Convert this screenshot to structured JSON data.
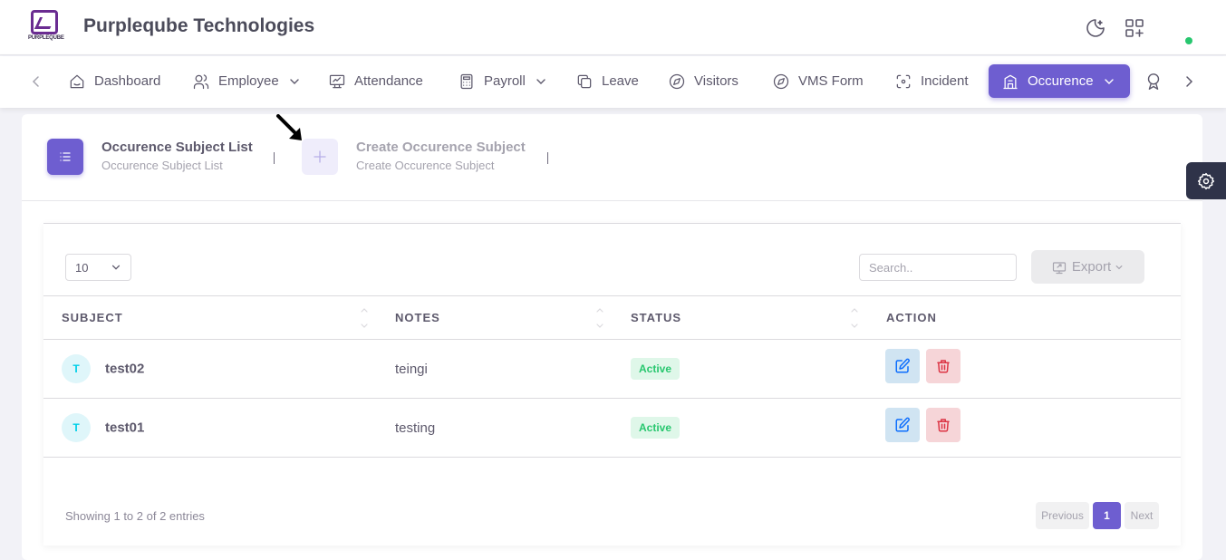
{
  "header": {
    "brand": "Purpleqube Technologies",
    "logo_text": "PURPLEQUBE",
    "icons": [
      "moon-icon",
      "apps-add-icon"
    ]
  },
  "navbar": {
    "items": [
      {
        "label": "Dashboard",
        "icon": "home-icon",
        "dropdown": false
      },
      {
        "label": "Employee",
        "icon": "users-icon",
        "dropdown": true
      },
      {
        "label": "Attendance",
        "icon": "chart-icon",
        "dropdown": false
      },
      {
        "label": "Payroll",
        "icon": "calculator-icon",
        "dropdown": true
      },
      {
        "label": "Leave",
        "icon": "copy-icon",
        "dropdown": false
      },
      {
        "label": "Visitors",
        "icon": "compass-icon",
        "dropdown": false
      },
      {
        "label": "VMS Form",
        "icon": "compass-icon",
        "dropdown": false
      },
      {
        "label": "Incident",
        "icon": "focus-icon",
        "dropdown": false
      },
      {
        "label": "Occurence",
        "icon": "building-icon",
        "dropdown": true,
        "active": true
      }
    ]
  },
  "tabs": [
    {
      "title": "Occurence Subject List",
      "subtitle": "Occurence Subject List",
      "active": true
    },
    {
      "title": "Create Occurence Subject",
      "subtitle": "Create Occurence Subject",
      "active": false
    }
  ],
  "table_controls": {
    "page_length": "10",
    "search_placeholder": "Search..",
    "export_label": "Export"
  },
  "table": {
    "columns": [
      "SUBJECT",
      "NOTES",
      "STATUS",
      "ACTION"
    ],
    "rows": [
      {
        "avatar": "T",
        "subject": "test02",
        "notes": "teingi",
        "status": "Active"
      },
      {
        "avatar": "T",
        "subject": "test01",
        "notes": "testing",
        "status": "Active"
      }
    ]
  },
  "footer": {
    "info": "Showing 1 to 2 of 2 entries",
    "previous": "Previous",
    "current_page": "1",
    "next": "Next"
  },
  "colors": {
    "primary": "#6e5ed0",
    "success": "#28c76f",
    "danger": "#ea5455",
    "info": "#00cfe8"
  }
}
